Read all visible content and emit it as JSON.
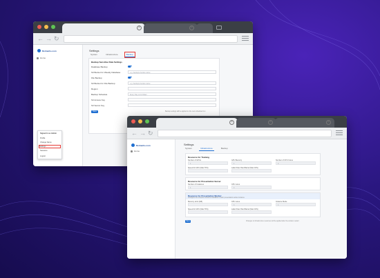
{
  "colors": {
    "accent": "#1f6fd1",
    "highlight": "#e53935",
    "background": "#2a1780"
  },
  "window1": {
    "sidebar": {
      "brand": "Retmarks.com",
      "items": [
        "Home"
      ]
    },
    "page_title": "Settings",
    "tabs": [
      "System",
      "Infrastructure",
      "Backup"
    ],
    "card_title": "Backup Sensitive Data Settings",
    "rows": [
      {
        "label": "Database Backup",
        "type": "toggle"
      },
      {
        "label": "S3 Bucket for Weekly Database",
        "type": "input",
        "placeholder": "e.g. backups-bucket-name"
      },
      {
        "label": "File Backup",
        "type": "toggle"
      },
      {
        "label": "S3 Bucket for File Backup",
        "type": "input",
        "placeholder": "e.g. backups-bucket-name"
      },
      {
        "label": "Region",
        "type": "input",
        "placeholder": ""
      },
      {
        "label": "Backup Schedule",
        "type": "input",
        "placeholder": "Every Day at 12:00am"
      },
      {
        "label": "S3 Access Key",
        "type": "input",
        "placeholder": ""
      },
      {
        "label": "S3 Secret Key",
        "type": "input",
        "placeholder": ""
      }
    ],
    "save_label": "Save",
    "save_hint": "Backup settings will be applied on the next scheduled run",
    "popup": {
      "header": "Signed in as Admin",
      "items": [
        "Profile",
        "Change Name",
        "Settings",
        "Sessions"
      ],
      "selected": "Settings",
      "footer": "Logout"
    }
  },
  "window2": {
    "sidebar": {
      "brand": "Retmarks.com",
      "items": [
        "Home"
      ]
    },
    "page_title": "Settings",
    "tabs": [
      "System",
      "Infrastructure",
      "Backup"
    ],
    "sections": [
      {
        "title": "Resource for Training",
        "fields": [
          {
            "label": "Number of GPUs",
            "value": "1"
          },
          {
            "label": "GPU Memory",
            "value": "1"
          },
          {
            "label": "Number of CPU Cores",
            "value": "4"
          },
          {
            "label": "Speed for GPU (Max TFS)",
            "value": ""
          },
          {
            "label": "Label Pass Hard Barrel (Max CFS)",
            "value": ""
          }
        ]
      },
      {
        "title": "Resource for Presentation Server",
        "fields": [
          {
            "label": "Number of Instances",
            "value": "1"
          },
          {
            "label": "CPU cores",
            "value": "4"
          }
        ]
      },
      {
        "title": "Resource for Presentation Worker",
        "description": "Configure the compute resources available to each presentation worker instance",
        "fields": [
          {
            "label": "Memory Limit (GB)",
            "value": ""
          },
          {
            "label": "CPU cores",
            "value": "4"
          },
          {
            "label": "Instance Mode",
            "value": "1"
          },
          {
            "label": "Speed for GPU (Max TFS)",
            "value": ""
          },
          {
            "label": "Label Pass Hard Barrel (Max CFS)",
            "value": ""
          }
        ]
      }
    ],
    "save_label": "Save",
    "save_hint": "Changes to infrastructure resources will be applied after the workers restart"
  }
}
